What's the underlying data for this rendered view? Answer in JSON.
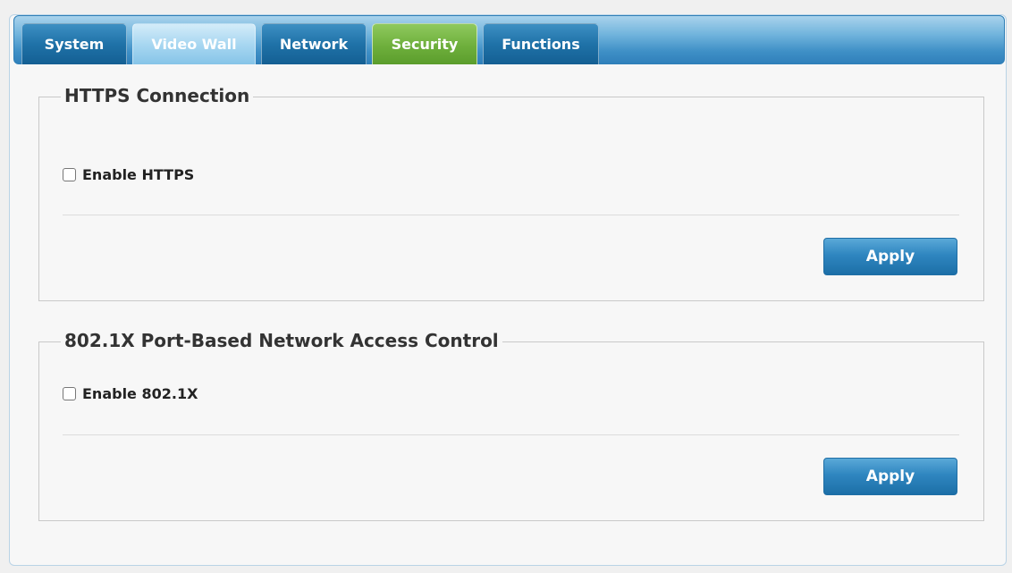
{
  "tabs": [
    {
      "label": "System",
      "state": "normal"
    },
    {
      "label": "Video Wall",
      "state": "light"
    },
    {
      "label": "Network",
      "state": "normal"
    },
    {
      "label": "Security",
      "state": "active"
    },
    {
      "label": "Functions",
      "state": "normal"
    }
  ],
  "https": {
    "title": "HTTPS Connection",
    "checkbox_label": "Enable HTTPS",
    "checked": false,
    "apply_label": "Apply"
  },
  "dot1x": {
    "title": "802.1X Port-Based Network Access Control",
    "checkbox_label": "Enable 802.1X",
    "checked": false,
    "apply_label": "Apply"
  },
  "colors": {
    "tab_active": "#6eaf3c",
    "tab_normal": "#1f72a8",
    "button": "#2f86c0"
  }
}
